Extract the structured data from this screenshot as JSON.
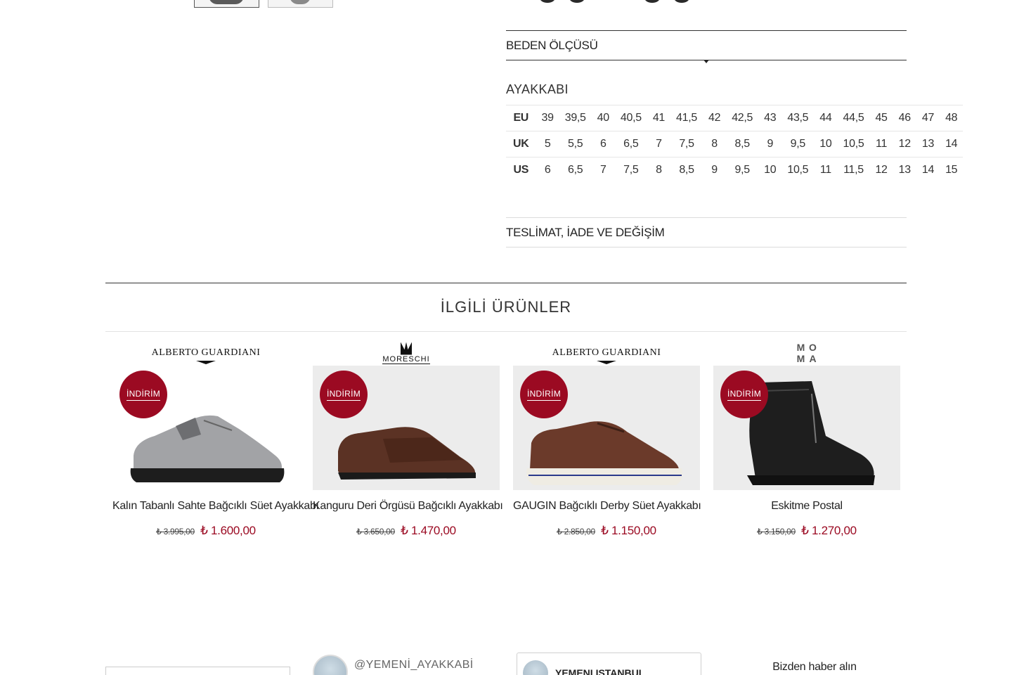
{
  "size_chart": {
    "heading": "BEDEN ÖLÇÜSÜ",
    "category": "AYAKKABI",
    "rows": [
      {
        "label": "EU",
        "values": [
          "39",
          "39,5",
          "40",
          "40,5",
          "41",
          "41,5",
          "42",
          "42,5",
          "43",
          "43,5",
          "44",
          "44,5",
          "45",
          "46",
          "47",
          "48"
        ]
      },
      {
        "label": "UK",
        "values": [
          "5",
          "5,5",
          "6",
          "6,5",
          "7",
          "7,5",
          "8",
          "8,5",
          "9",
          "9,5",
          "10",
          "10,5",
          "11",
          "12",
          "13",
          "14"
        ]
      },
      {
        "label": "US",
        "values": [
          "6",
          "6,5",
          "7",
          "7,5",
          "8",
          "8,5",
          "9",
          "9,5",
          "10",
          "10,5",
          "11",
          "11,5",
          "12",
          "13",
          "14",
          "15"
        ]
      }
    ]
  },
  "shipping": {
    "heading": "TESLİMAT, İADE VE DEĞİŞİM"
  },
  "related": {
    "title": "İLGİLİ ÜRÜNLER",
    "products": [
      {
        "brand": "ALBERTO GUARDIANI",
        "badge": "İNDİRİM",
        "name": "Kalın Tabanlı Sahte Bağcıklı Süet Ayakkabı",
        "old_price": "₺ 3.995,00",
        "new_price": "₺ 1.600,00",
        "image": "grey-suede-shoe"
      },
      {
        "brand": "MORESCHI",
        "badge": "İNDİRİM",
        "name": "Kanguru Deri Örgüsü Bağcıklı Ayakkabı",
        "old_price": "₺ 3.650,00",
        "new_price": "₺ 1.470,00",
        "image": "brown-woven-shoe"
      },
      {
        "brand": "ALBERTO GUARDIANI",
        "badge": "İNDİRİM",
        "name": "GAUGIN Bağcıklı Derby Süet Ayakkabı",
        "old_price": "₺ 2.850,00",
        "new_price": "₺ 1.150,00",
        "image": "brown-suede-derby"
      },
      {
        "brand": "MOMA",
        "badge": "İNDİRİM",
        "name": "Eskitme Postal",
        "old_price": "₺ 3.150,00",
        "new_price": "₺ 1.270,00",
        "image": "black-leather-boot"
      }
    ]
  },
  "footer": {
    "instagram_handle": "@YEMENİ_AYAKKABİ",
    "facebook_name": "YEMENI ISTANBUL",
    "newsletter_title": "Bizden haber alın"
  }
}
